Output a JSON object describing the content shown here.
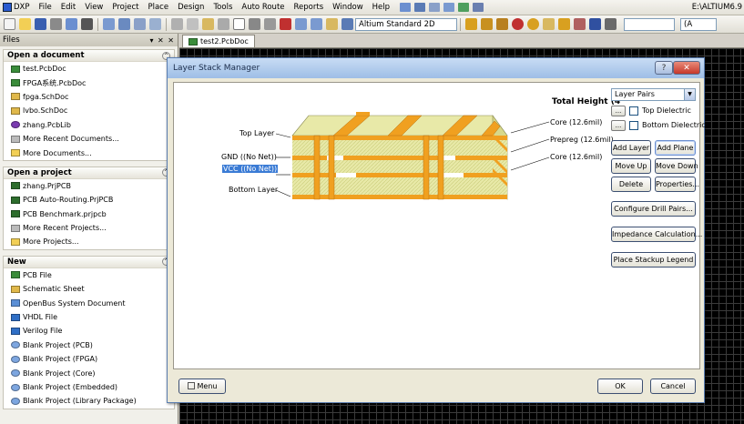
{
  "menubar": {
    "app_label": "DXP",
    "items": [
      "File",
      "Edit",
      "View",
      "Project",
      "Place",
      "Design",
      "Tools",
      "Auto Route",
      "Reports",
      "Window",
      "Help"
    ],
    "title_path": "E:\\ALTIUM6.9"
  },
  "toolbar": {
    "layer_combo": "Altium Standard 2D",
    "right_combo": "(A"
  },
  "panel": {
    "title": "Files",
    "controls": "▾ ✕ ✕",
    "sections": [
      {
        "title": "Open a document",
        "items": [
          {
            "label": "test.PcbDoc",
            "icon": "pcb-doc-icon"
          },
          {
            "label": "FPGA系统.PcbDoc",
            "icon": "pcb-doc-icon"
          },
          {
            "label": "fpga.SchDoc",
            "icon": "sch-doc-icon"
          },
          {
            "label": "lvbo.SchDoc",
            "icon": "sch-doc-icon"
          },
          {
            "label": "zhang.PcbLib",
            "icon": "pcb-lib-icon"
          },
          {
            "label": "More Recent Documents...",
            "icon": "more-icon"
          },
          {
            "label": "More Documents...",
            "icon": "folder-icon"
          }
        ]
      },
      {
        "title": "Open a project",
        "items": [
          {
            "label": "zhang.PrjPCB",
            "icon": "project-icon"
          },
          {
            "label": "PCB Auto-Routing.PrjPCB",
            "icon": "project-icon"
          },
          {
            "label": "PCB Benchmark.prjpcb",
            "icon": "project-icon"
          },
          {
            "label": "More Recent Projects...",
            "icon": "more-icon"
          },
          {
            "label": "More Projects...",
            "icon": "folder-icon"
          }
        ]
      },
      {
        "title": "New",
        "items": [
          {
            "label": "PCB File",
            "icon": "pcb-doc-icon"
          },
          {
            "label": "Schematic Sheet",
            "icon": "sch-doc-icon"
          },
          {
            "label": "OpenBus System Document",
            "icon": "doc-icon"
          },
          {
            "label": "VHDL File",
            "icon": "vhdl-icon"
          },
          {
            "label": "Verilog File",
            "icon": "vhdl-icon"
          },
          {
            "label": "Blank Project (PCB)",
            "icon": "blank-project-icon"
          },
          {
            "label": "Blank Project (FPGA)",
            "icon": "blank-project-icon"
          },
          {
            "label": "Blank Project (Core)",
            "icon": "blank-project-icon"
          },
          {
            "label": "Blank Project (Embedded)",
            "icon": "blank-project-icon"
          },
          {
            "label": "Blank Project (Library Package)",
            "icon": "blank-project-icon"
          }
        ]
      }
    ]
  },
  "doc_tab": {
    "label": "test2.PcbDoc"
  },
  "dialog": {
    "title": "Layer Stack Manager",
    "help_label": "?",
    "close_label": "✕",
    "total_height": "Total Height (4",
    "stack_labels": {
      "top": "Top Layer",
      "gnd": "GND ((No Net))",
      "vcc": "VCC ((No Net))",
      "bottom": "Bottom Layer",
      "core1": "Core (12.6mil)",
      "prepreg": "Prepreg (12.6mil)",
      "core2": "Core (12.6mil)"
    },
    "layer_pairs_value": "Layer Pairs",
    "top_dielectric": "Top Dielectric",
    "bottom_dielectric": "Bottom Dielectric",
    "mini_btn": "...",
    "buttons": {
      "add_layer": "Add Layer",
      "add_plane": "Add Plane",
      "move_up": "Move Up",
      "move_down": "Move Down",
      "delete": "Delete",
      "properties": "Properties...",
      "configure_drill": "Configure Drill Pairs...",
      "impedance": "Impedance Calculation...",
      "legend": "Place Stackup Legend"
    },
    "menu_label": "Menu",
    "ok_label": "OK",
    "cancel_label": "Cancel"
  },
  "colors": {
    "copper": "#f0a020",
    "dielectric": "#e8e9a8",
    "dialog_bg": "#ece9d8"
  }
}
